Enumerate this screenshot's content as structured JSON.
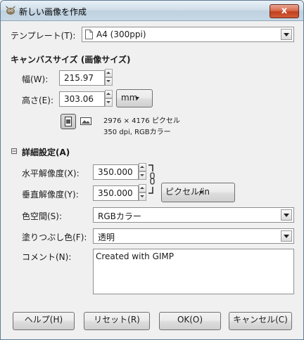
{
  "window": {
    "title": "新しい画像を作成",
    "close_label": "x"
  },
  "template": {
    "label": "テンプレート(T):",
    "value": "A4 (300ppi)"
  },
  "canvas_size": {
    "heading": "キャンバスサイズ (画像サイズ)",
    "width_label": "幅(W):",
    "width_value": "215.97",
    "height_label": "高さ(E):",
    "height_value": "303.06",
    "unit": "mm",
    "info_pixels": "2976 × 4176 ピクセル",
    "info_dpi": "350 dpi, RGBカラー"
  },
  "advanced": {
    "heading": "詳細設定(A)",
    "toggle_glyph": "⊟",
    "xres_label": "水平解像度(X):",
    "xres_value": "350.000",
    "yres_label": "垂直解像度(Y):",
    "yres_value": "350.000",
    "res_unit": "ピクセル/in",
    "colorspace_label": "色空間(S):",
    "colorspace_value": "RGBカラー",
    "fill_label": "塗りつぶし色(F):",
    "fill_value": "透明",
    "comment_label": "コメント(N):",
    "comment_value": "Created with GIMP"
  },
  "buttons": {
    "help": "ヘルプ(H)",
    "reset": "リセット(R)",
    "ok": "OK(O)",
    "cancel": "キャンセル(C)"
  }
}
